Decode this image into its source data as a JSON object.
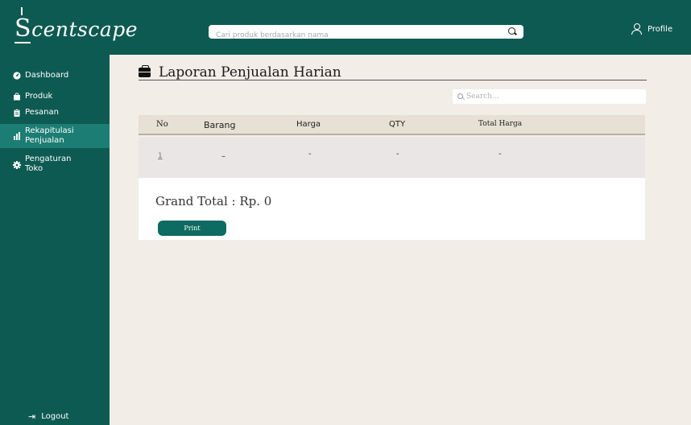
{
  "header": {
    "logo": {
      "first_letter": "S",
      "rest": "centscape"
    },
    "search_placeholder": "Cari produk berdasarkan nama",
    "search_icon": "search-icon",
    "profile_label": "Profile",
    "profile_icon": "user-icon"
  },
  "sidebar": {
    "items": [
      {
        "label": "Dashboard",
        "icon": "dashboard-gauge-icon",
        "active": false
      },
      {
        "label": "Produk",
        "icon": "shopping-bag-icon",
        "active": false
      },
      {
        "label": "Pesanan",
        "icon": "clipboard-icon",
        "active": false
      },
      {
        "label": "Rekapitulasi Penjualan",
        "icon": "bar-chart-icon",
        "active": true
      },
      {
        "label": "Pengaturan Toko",
        "icon": "gear-icon",
        "active": false
      }
    ],
    "logout_label": "Logout",
    "logout_icon": "logout-icon"
  },
  "main": {
    "title": "Laporan Penjualan Harian",
    "title_icon": "briefcase-icon",
    "table_search_placeholder": "Search...",
    "table": {
      "columns": [
        "No",
        "Barang",
        "Harga",
        "QTY",
        "Total Harga"
      ],
      "rows": [
        [
          "1",
          "–",
          "-",
          "-",
          "-"
        ]
      ]
    },
    "grand_total": "Grand Total : Rp. 0",
    "print_label": "Print"
  },
  "colors": {
    "brand": "#0d5a52",
    "active_nav": "#1b7d73",
    "page_bg": "#f2ede6",
    "table_header": "#e6e1d4",
    "button": "#0d6b61"
  }
}
